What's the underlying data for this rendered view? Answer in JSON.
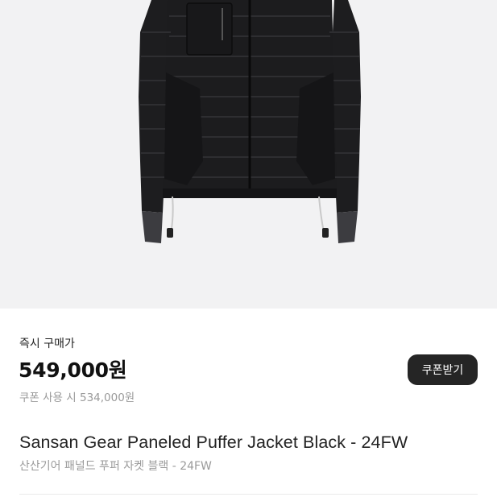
{
  "product": {
    "image_alt": "Black paneled puffer jacket",
    "buy_now_label": "즉시 구매가",
    "price": "549,000원",
    "coupon_price": "쿠폰 사용 시 534,000원",
    "coupon_button_label": "쿠폰받기",
    "title": "Sansan Gear Paneled Puffer Jacket Black - 24FW",
    "subtitle": "산산기어 패널드 푸퍼 자켓 블랙 - 24FW"
  },
  "colors": {
    "image_background": "#f2f2f3",
    "jacket": "#1c1c1e",
    "button_background": "#252525",
    "muted_text": "#9a9a9a"
  }
}
